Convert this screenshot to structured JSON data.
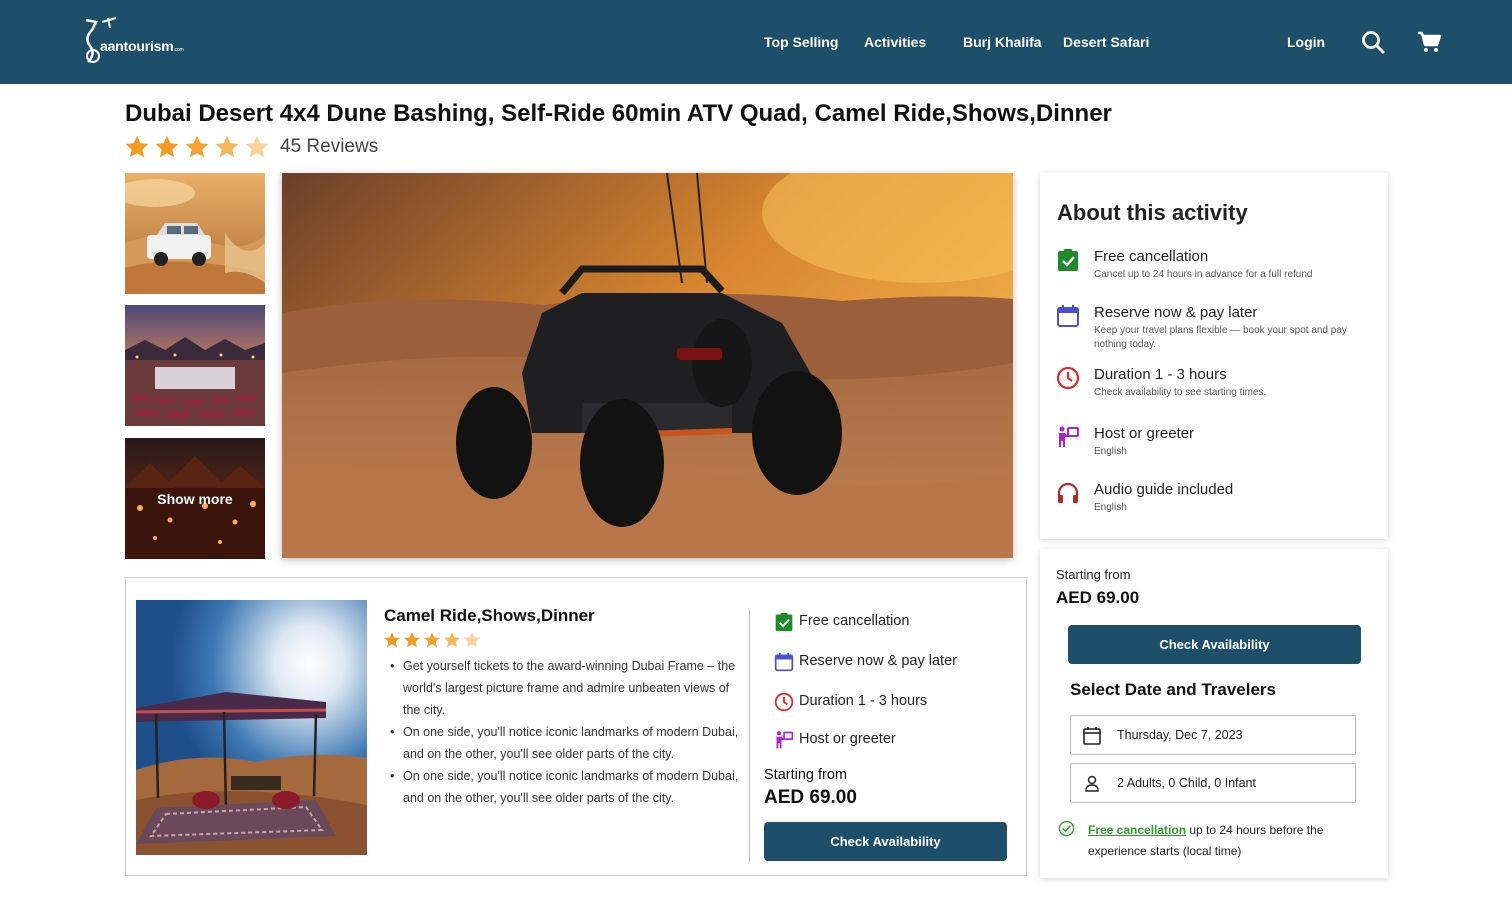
{
  "header": {
    "logo_text": "aantourism",
    "logo_suffix": ".com",
    "nav": [
      "Top Selling",
      "Activities",
      "Burj Khalifa",
      "Desert Safari"
    ],
    "login": "Login",
    "icons": [
      "search-icon",
      "cart-icon"
    ],
    "bg_color": "#1d4f6b"
  },
  "product": {
    "title": "Dubai Desert 4x4 Dune Bashing, Self-Ride 60min ATV Quad, Camel Ride,Shows,Dinner",
    "rating": 4.5,
    "reviews": "45 Reviews"
  },
  "gallery": {
    "show_more": "Show more"
  },
  "about": {
    "title": "About this activity",
    "features": [
      {
        "icon": "check-clipboard-icon",
        "title": "Free cancellation",
        "sub": "Cancel up to 24 hours in advance for a full refund"
      },
      {
        "icon": "calendar-icon",
        "title": "Reserve now & pay later",
        "sub": "Keep your travel plans flexible — book your spot and pay nothing today."
      },
      {
        "icon": "clock-icon",
        "title": "Duration 1 - 3 hours",
        "sub": "Check availability to see starting times."
      },
      {
        "icon": "host-icon",
        "title": "Host or greeter",
        "sub": "English"
      },
      {
        "icon": "headphones-icon",
        "title": "Audio guide included",
        "sub": "English"
      }
    ]
  },
  "booking": {
    "from_label": "Starting from",
    "price": "AED 69.00",
    "button": "Check Availability",
    "select_title": "Select Date and Travelers",
    "date": "Thursday, Dec 7, 2023",
    "travelers": "2 Adults, 0 Child, 0 Infant",
    "free_cancel_link": "Free cancellation",
    "free_cancel_text": " up to 24 hours before the experience starts (local time)"
  },
  "option": {
    "title": "Camel Ride,Shows,Dinner",
    "rating": 4.5,
    "bullets": [
      "Get yourself tickets to the award-winning Dubai Frame – the world's largest picture frame and admire unbeaten views of the city.",
      "On one side, you'll notice iconic landmarks of modern Dubai, and on the other, you'll see older parts of the city.",
      "On one side, you'll notice iconic landmarks of modern Dubai, and on the other, you'll see older parts of the city."
    ],
    "features": [
      {
        "icon": "check-clipboard-icon",
        "title": "Free cancellation"
      },
      {
        "icon": "calendar-icon",
        "title": "Reserve now & pay later"
      },
      {
        "icon": "clock-icon",
        "title": "Duration 1 - 3 hours"
      },
      {
        "icon": "host-icon",
        "title": "Host or greeter"
      }
    ],
    "from_label": "Starting from",
    "price": "AED 69.00",
    "button": "Check Availability"
  }
}
